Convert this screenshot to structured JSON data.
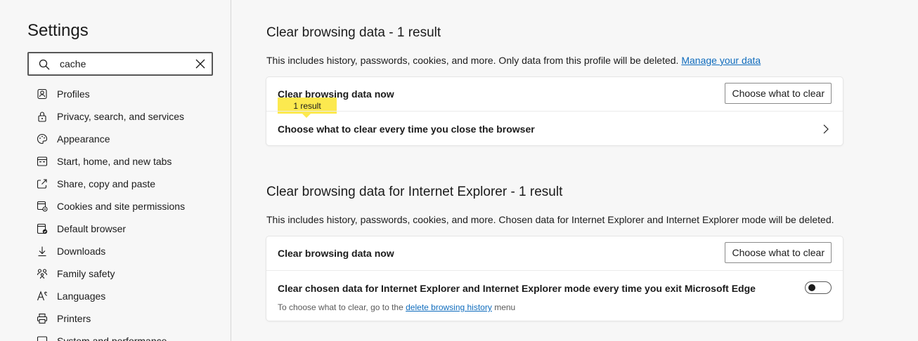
{
  "sidebar": {
    "title": "Settings",
    "search": {
      "value": "cache",
      "placeholder": "Search settings"
    },
    "items": [
      {
        "label": "Profiles",
        "icon": "profile-icon"
      },
      {
        "label": "Privacy, search, and services",
        "icon": "lock-icon"
      },
      {
        "label": "Appearance",
        "icon": "palette-icon"
      },
      {
        "label": "Start, home, and new tabs",
        "icon": "home-tabs-icon"
      },
      {
        "label": "Share, copy and paste",
        "icon": "share-icon"
      },
      {
        "label": "Cookies and site permissions",
        "icon": "cookies-icon"
      },
      {
        "label": "Default browser",
        "icon": "browser-icon"
      },
      {
        "label": "Downloads",
        "icon": "download-icon"
      },
      {
        "label": "Family safety",
        "icon": "family-icon"
      },
      {
        "label": "Languages",
        "icon": "language-icon"
      },
      {
        "label": "Printers",
        "icon": "printer-icon"
      },
      {
        "label": "System and performance",
        "icon": "system-icon"
      }
    ]
  },
  "main": {
    "sections": [
      {
        "title": "Clear browsing data - 1 result",
        "description": "This includes history, passwords, cookies, and more. Only data from this profile will be deleted.",
        "link": "Manage your data",
        "rows": [
          {
            "label": "Clear browsing data now",
            "button": "Choose what to clear",
            "badge": "1 result"
          },
          {
            "label": "Choose what to clear every time you close the browser"
          }
        ]
      },
      {
        "title": "Clear browsing data for Internet Explorer - 1 result",
        "description": "This includes history, passwords, cookies, and more. Chosen data for Internet Explorer and Internet Explorer mode will be deleted.",
        "rows": [
          {
            "label": "Clear browsing data now",
            "button": "Choose what to clear"
          },
          {
            "label": "Clear chosen data for Internet Explorer and Internet Explorer mode every time you exit Microsoft Edge",
            "toggle_on": false,
            "subtext_prefix": "To choose what to clear, go to the",
            "subtext_link": "delete browsing history",
            "subtext_suffix": "menu"
          }
        ]
      }
    ]
  },
  "colors": {
    "accent": "#0f6cbd",
    "highlight": "#fce94f",
    "background": "#f7f7f7"
  }
}
